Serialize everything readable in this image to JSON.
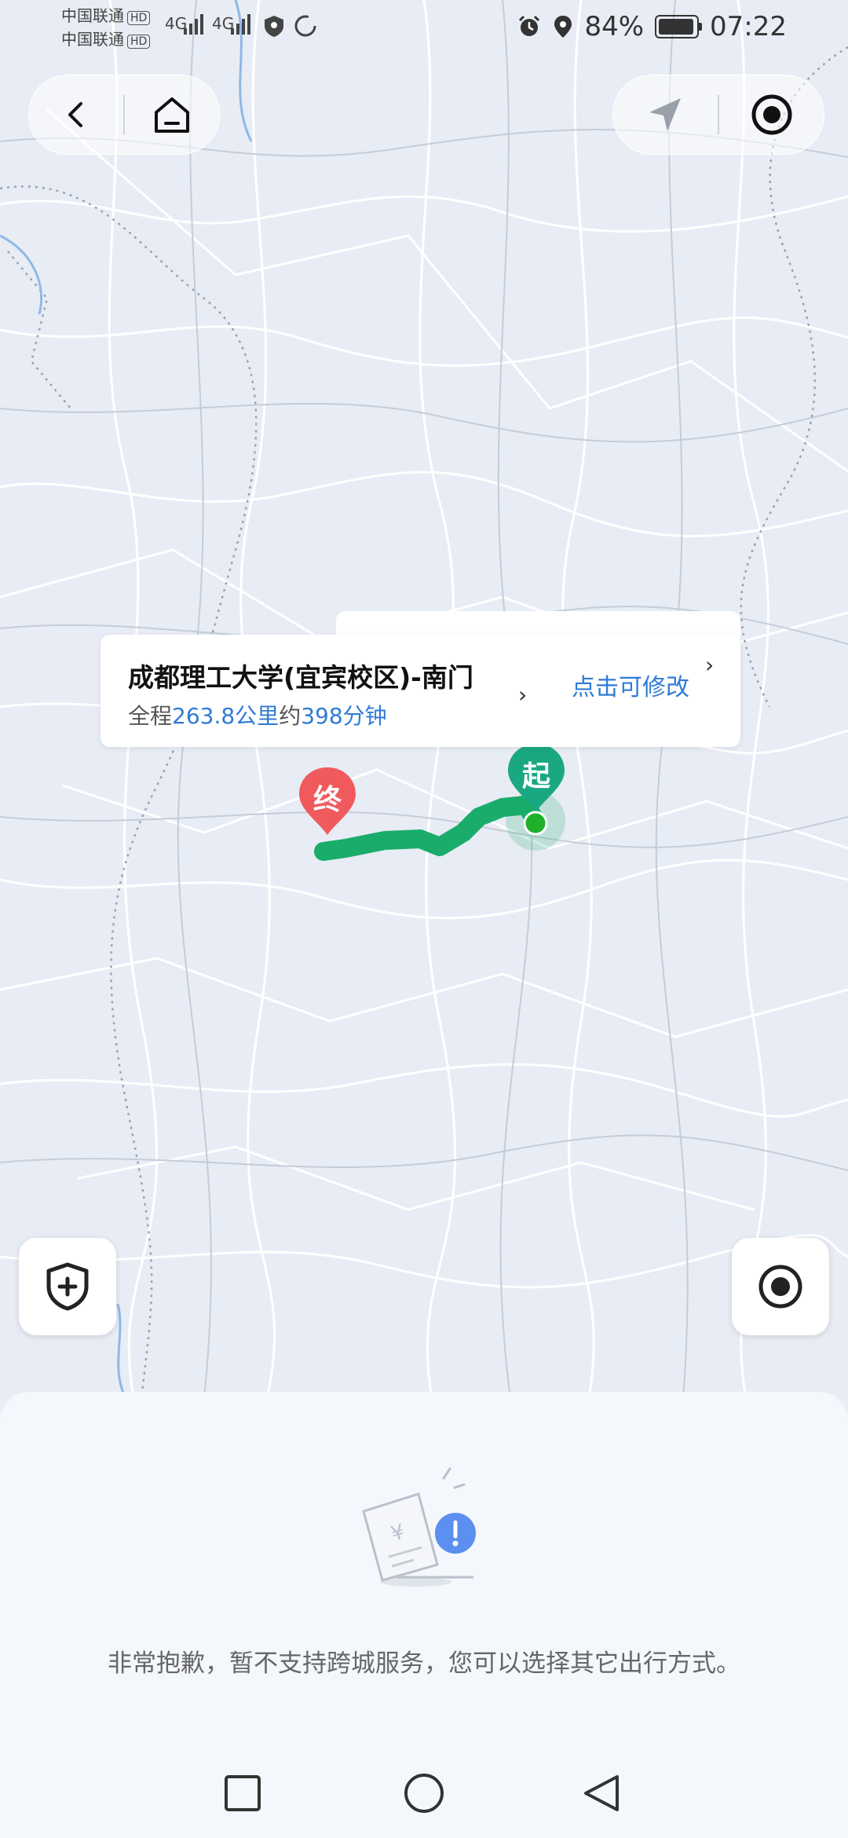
{
  "status_bar": {
    "carrier1": "中国联通",
    "carrier2": "中国联通",
    "hd_badge": "HD",
    "network1": "4G",
    "network2": "4G",
    "battery_percent": "84%",
    "battery_level": 0.84,
    "time": "07:22"
  },
  "map": {
    "start_marker": "起",
    "end_marker": "终",
    "route_color": "#1aac6b"
  },
  "route_card": {
    "destination": "成都理工大学(宜宾校区)-南门",
    "summary_prefix": "全程",
    "distance": "263.8公里",
    "summary_mid": "约",
    "duration": "398分钟",
    "modify_label": "点击可修改",
    "chevron": "›"
  },
  "sheet": {
    "message": "非常抱歉，暂不支持跨城服务，您可以选择其它出行方式。"
  },
  "colors": {
    "accent": "#2f7bd6",
    "start_green": "#1aa883",
    "end_red": "#f05a5d"
  }
}
